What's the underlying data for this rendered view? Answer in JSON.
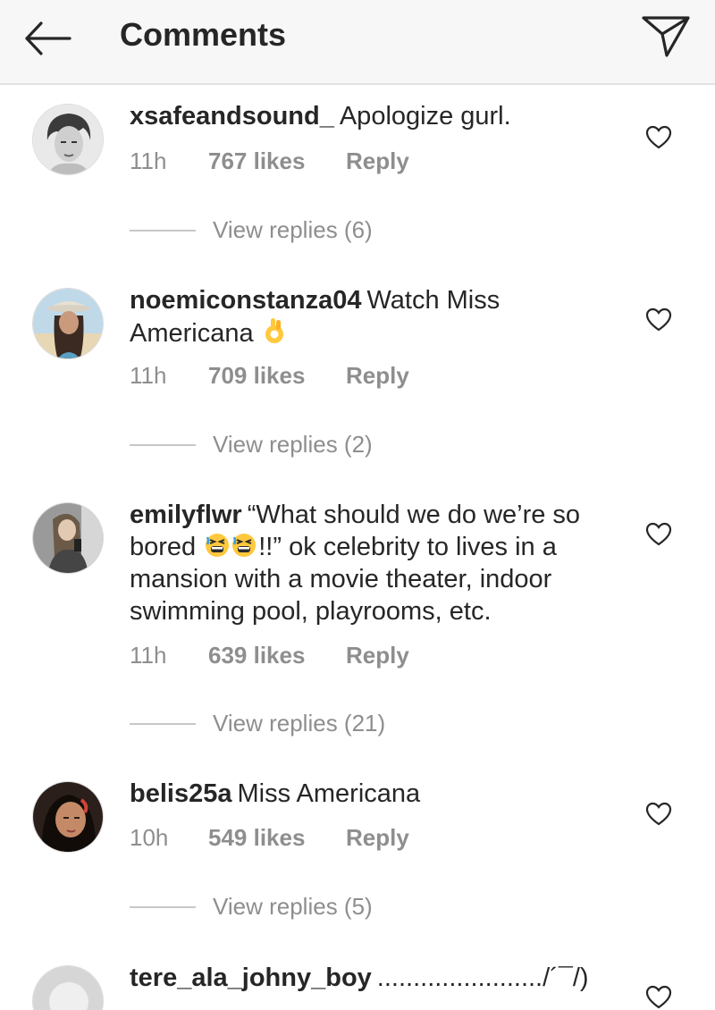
{
  "header": {
    "back_icon": "arrow-left-icon",
    "title": "Comments",
    "send_icon": "paper-plane-icon"
  },
  "comments": [
    {
      "username": "xsafeandsound_",
      "text": "Apologize gurl.",
      "time": "11h",
      "likes": "767 likes",
      "reply": "Reply",
      "view_replies": "View replies (6)"
    },
    {
      "username": "noemiconstanza04",
      "text_before": "Watch Miss Americana",
      "emoji": "ok-hand-emoji",
      "time": "11h",
      "likes": "709 likes",
      "reply": "Reply",
      "view_replies": "View replies (2)"
    },
    {
      "username": "emilyflwr",
      "text_before": "“What should we do we’re so bored",
      "emoji": "tired-face-emoji",
      "text_after": "!!” ok celebrity to lives in a mansion with a movie theater, indoor swimming pool, playrooms, etc.",
      "time": "11h",
      "likes": "639 likes",
      "reply": "Reply",
      "view_replies": "View replies (21)"
    },
    {
      "username": "belis25a",
      "text": "Miss Americana",
      "time": "10h",
      "likes": "549 likes",
      "reply": "Reply",
      "view_replies": "View replies (5)"
    },
    {
      "username": "tere_ala_johny_boy",
      "text": "......................./´¯/)"
    }
  ],
  "colors": {
    "text": "#262626",
    "muted": "#8e8e8e",
    "header_bg": "#f7f7f7",
    "emoji_yellow": "#ffc83d",
    "emoji_blue": "#3aa0d8"
  }
}
